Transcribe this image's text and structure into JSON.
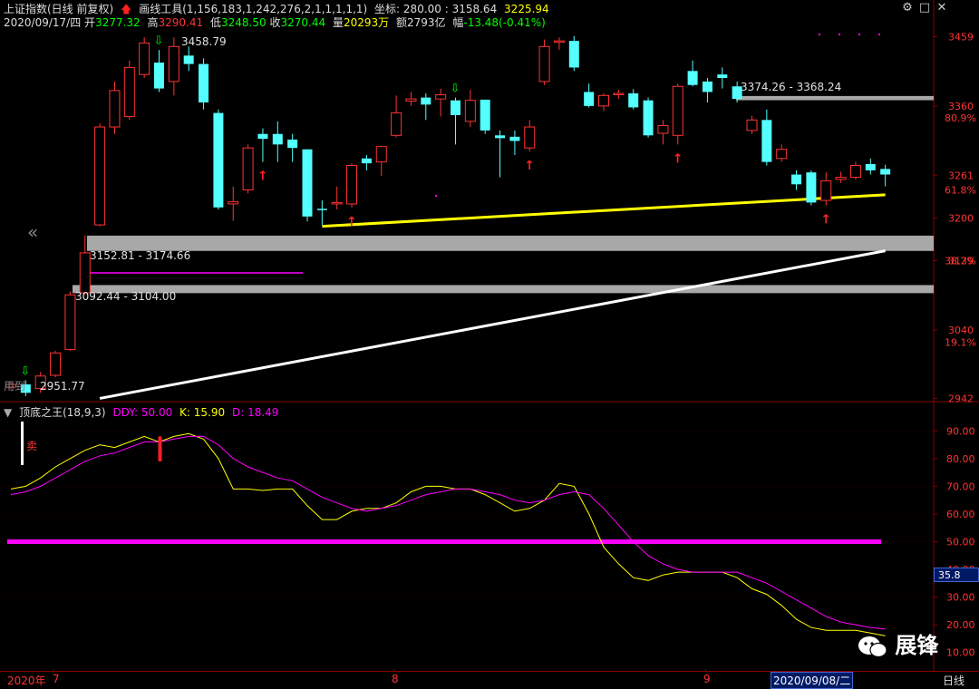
{
  "header": {
    "title": "上证指数(日线 前复权)",
    "tool": "画线工具(1,156,183,1,242,276,2,1,1,1,1,1)",
    "coord_label": "坐标:",
    "coord_value": "280.00 : 3158.64",
    "coord_price": "3225.94",
    "date": "2020/09/17/四",
    "open_label": "开",
    "open": "3277.32",
    "high_label": "高",
    "high": "3290.41",
    "low_label": "低",
    "low": "3248.50",
    "close_label": "收",
    "close": "3270.44",
    "vol_label": "量",
    "vol": "20293万",
    "amt_label": "额",
    "amt": "2793亿",
    "chg_label": "幅",
    "chg": "-13.48(-0.41%)"
  },
  "indicator": {
    "name": "顶底之王",
    "params": "(18,9,3)",
    "ddy": "DDY: 50.00",
    "k": "K: 15.90",
    "d": "D: 18.49",
    "sell_label": "卖",
    "current_box": "35.8"
  },
  "bottom": {
    "year": "2020年",
    "m7": "7",
    "m8": "8",
    "m9": "9",
    "cursor_date": "2020/09/08/二",
    "period": "日线"
  },
  "watermark": "展锋",
  "partial_text": "用到",
  "colors": {
    "up": "#ff3333",
    "down": "#54ffff",
    "yellow": "#ffff00",
    "magenta": "#ff00ff",
    "white": "#ffffff",
    "gray": "#a0a0a0",
    "green": "#00ff00",
    "axis": "#8b0000"
  },
  "chart_data": [
    {
      "type": "candlestick",
      "title": "上证指数(日线 前复权)",
      "y_ticks": [
        2942,
        3040,
        3139,
        3200,
        3261,
        3360,
        3459
      ],
      "y_pct_labels": [
        {
          "v": 3022,
          "label": "19.1%"
        },
        {
          "v": 3139,
          "label": "38.2%"
        },
        {
          "v": 3240,
          "label": "61.8%"
        },
        {
          "v": 3343,
          "label": "80.9%"
        }
      ],
      "ylim": [
        2940,
        3470
      ],
      "candles": [
        {
          "o": 2958,
          "c": 2962,
          "h": 2965,
          "l": 2955
        },
        {
          "o": 2962,
          "c": 2950,
          "h": 2968,
          "l": 2945
        },
        {
          "o": 2956,
          "c": 2974,
          "h": 2980,
          "l": 2950
        },
        {
          "o": 2975,
          "c": 3007,
          "h": 3010,
          "l": 2972
        },
        {
          "o": 3012,
          "c": 3090,
          "h": 3095,
          "l": 3010
        },
        {
          "o": 3093,
          "c": 3150,
          "h": 3175,
          "l": 3090
        },
        {
          "o": 3190,
          "c": 3330,
          "h": 3335,
          "l": 3188
        },
        {
          "o": 3330,
          "c": 3382,
          "h": 3395,
          "l": 3320
        },
        {
          "o": 3345,
          "c": 3415,
          "h": 3425,
          "l": 3340
        },
        {
          "o": 3405,
          "c": 3450,
          "h": 3458,
          "l": 3400
        },
        {
          "o": 3422,
          "c": 3385,
          "h": 3440,
          "l": 3380
        },
        {
          "o": 3395,
          "c": 3445,
          "h": 3458,
          "l": 3375
        },
        {
          "o": 3432,
          "c": 3420,
          "h": 3445,
          "l": 3410
        },
        {
          "o": 3420,
          "c": 3365,
          "h": 3428,
          "l": 3355
        },
        {
          "o": 3350,
          "c": 3215,
          "h": 3355,
          "l": 3212
        },
        {
          "o": 3220,
          "c": 3223,
          "h": 3245,
          "l": 3196
        },
        {
          "o": 3240,
          "c": 3300,
          "h": 3305,
          "l": 3235
        },
        {
          "o": 3320,
          "c": 3313,
          "h": 3328,
          "l": 3280
        },
        {
          "o": 3320,
          "c": 3305,
          "h": 3338,
          "l": 3280
        },
        {
          "o": 3312,
          "c": 3300,
          "h": 3320,
          "l": 3280
        },
        {
          "o": 3298,
          "c": 3202,
          "h": 3298,
          "l": 3195
        },
        {
          "o": 3213,
          "c": 3212,
          "h": 3225,
          "l": 3190
        },
        {
          "o": 3220,
          "c": 3222,
          "h": 3245,
          "l": 3212
        },
        {
          "o": 3220,
          "c": 3275,
          "h": 3278,
          "l": 3215
        },
        {
          "o": 3285,
          "c": 3278,
          "h": 3290,
          "l": 3268
        },
        {
          "o": 3280,
          "c": 3302,
          "h": 3302,
          "l": 3260
        },
        {
          "o": 3318,
          "c": 3350,
          "h": 3375,
          "l": 3315
        },
        {
          "o": 3367,
          "c": 3370,
          "h": 3380,
          "l": 3360
        },
        {
          "o": 3372,
          "c": 3362,
          "h": 3378,
          "l": 3340
        },
        {
          "o": 3370,
          "c": 3376,
          "h": 3385,
          "l": 3345
        },
        {
          "o": 3368,
          "c": 3347,
          "h": 3372,
          "l": 3305
        },
        {
          "o": 3338,
          "c": 3368,
          "h": 3383,
          "l": 3330
        },
        {
          "o": 3369,
          "c": 3325,
          "h": 3369,
          "l": 3320
        },
        {
          "o": 3318,
          "c": 3314,
          "h": 3325,
          "l": 3258
        },
        {
          "o": 3316,
          "c": 3310,
          "h": 3325,
          "l": 3290
        },
        {
          "o": 3300,
          "c": 3330,
          "h": 3340,
          "l": 3295
        },
        {
          "o": 3395,
          "c": 3445,
          "h": 3455,
          "l": 3390
        },
        {
          "o": 3451,
          "c": 3453,
          "h": 3458,
          "l": 3440
        },
        {
          "o": 3453,
          "c": 3415,
          "h": 3460,
          "l": 3410
        },
        {
          "o": 3380,
          "c": 3360,
          "h": 3392,
          "l": 3358
        },
        {
          "o": 3360,
          "c": 3375,
          "h": 3378,
          "l": 3353
        },
        {
          "o": 3378,
          "c": 3378,
          "h": 3383,
          "l": 3370
        },
        {
          "o": 3378,
          "c": 3358,
          "h": 3384,
          "l": 3355
        },
        {
          "o": 3368,
          "c": 3318,
          "h": 3372,
          "l": 3315
        },
        {
          "o": 3321,
          "c": 3332,
          "h": 3340,
          "l": 3305
        },
        {
          "o": 3318,
          "c": 3388,
          "h": 3392,
          "l": 3305
        },
        {
          "o": 3410,
          "c": 3390,
          "h": 3425,
          "l": 3388
        },
        {
          "o": 3395,
          "c": 3380,
          "h": 3400,
          "l": 3365
        },
        {
          "o": 3405,
          "c": 3400,
          "h": 3415,
          "l": 3385
        },
        {
          "o": 3388,
          "c": 3370,
          "h": 3395,
          "l": 3365
        },
        {
          "o": 3325,
          "c": 3340,
          "h": 3346,
          "l": 3320
        },
        {
          "o": 3340,
          "c": 3280,
          "h": 3355,
          "l": 3275
        },
        {
          "o": 3285,
          "c": 3298,
          "h": 3305,
          "l": 3280
        },
        {
          "o": 3262,
          "c": 3248,
          "h": 3268,
          "l": 3240
        },
        {
          "o": 3265,
          "c": 3222,
          "h": 3268,
          "l": 3218
        },
        {
          "o": 3225,
          "c": 3253,
          "h": 3265,
          "l": 3218
        },
        {
          "o": 3255,
          "c": 3258,
          "h": 3266,
          "l": 3250
        },
        {
          "o": 3258,
          "c": 3275,
          "h": 3280,
          "l": 3255
        },
        {
          "o": 3277,
          "c": 3268,
          "h": 3285,
          "l": 3262
        },
        {
          "o": 3270,
          "c": 3262,
          "h": 3276,
          "l": 3245
        }
      ],
      "annotations": [
        {
          "label": "3458.79"
        },
        {
          "label": "3374.26 - 3368.24"
        },
        {
          "label": "3152.81 - 3174.66"
        },
        {
          "label": "3092.44 - 3104.00"
        },
        {
          "label": "2951.77"
        }
      ],
      "bands": [
        {
          "y1": 3152.81,
          "y2": 3174.66
        },
        {
          "y1": 3092.44,
          "y2": 3104.0
        },
        {
          "y1": 3368.24,
          "y2": 3374.26
        }
      ],
      "trendlines": [
        {
          "color": "yellow",
          "from": {
            "i": 21,
            "v": 3188
          },
          "to": {
            "i": 59,
            "v": 3233
          }
        },
        {
          "color": "white",
          "from": {
            "i": 6,
            "v": 2942
          },
          "to": {
            "i": 59,
            "v": 3153
          }
        }
      ],
      "x_ticks": [
        {
          "i": 3,
          "label": "7"
        },
        {
          "i": 26,
          "label": "8"
        },
        {
          "i": 47,
          "label": "9"
        }
      ]
    },
    {
      "type": "line",
      "title": "顶底之王(18,9,3)",
      "y_ticks": [
        10,
        20,
        30,
        40,
        50,
        60,
        70,
        80,
        90
      ],
      "ylim": [
        5,
        95
      ],
      "series": [
        {
          "name": "DDY",
          "values": [
            50,
            50,
            50,
            50,
            50,
            50,
            50,
            50,
            50,
            50,
            50,
            50,
            50,
            50,
            50,
            50,
            50,
            50,
            50,
            50,
            50,
            50,
            50,
            50,
            50,
            50,
            50,
            50,
            50,
            50,
            50,
            50,
            50,
            50,
            50,
            50,
            50,
            50,
            50,
            50,
            50,
            50,
            50,
            50,
            50,
            50,
            50,
            50,
            50,
            50,
            50,
            50,
            50,
            50,
            50,
            50,
            50,
            50,
            50,
            50
          ]
        },
        {
          "name": "K",
          "values": [
            69,
            70,
            73,
            77,
            80,
            83,
            85,
            84,
            86,
            88,
            86,
            88,
            89,
            87,
            80,
            69,
            69,
            68.5,
            69,
            69,
            63,
            58,
            58,
            61,
            62,
            62,
            64,
            68,
            70,
            70,
            69,
            69,
            67,
            64,
            61,
            62,
            65,
            71,
            70,
            60,
            48,
            42,
            37,
            36,
            38,
            39,
            39,
            39,
            39,
            37,
            33,
            31,
            27,
            22,
            19,
            18,
            18,
            18,
            17,
            16
          ]
        },
        {
          "name": "D",
          "values": [
            67,
            68,
            70,
            73,
            76,
            79,
            81,
            82,
            84,
            86,
            86,
            87,
            88,
            88,
            85,
            80,
            77,
            75,
            73,
            72,
            69,
            66,
            64,
            62,
            61,
            62,
            63,
            65,
            67,
            68,
            69,
            69,
            68,
            67,
            65,
            64,
            65,
            67,
            68,
            67,
            62,
            56,
            50,
            45,
            42,
            40,
            39,
            39,
            39,
            39,
            37,
            35,
            32,
            29,
            26,
            23,
            21,
            20,
            19,
            18.5
          ]
        }
      ],
      "markers": [
        {
          "i": 10,
          "label": "卖"
        }
      ]
    }
  ]
}
